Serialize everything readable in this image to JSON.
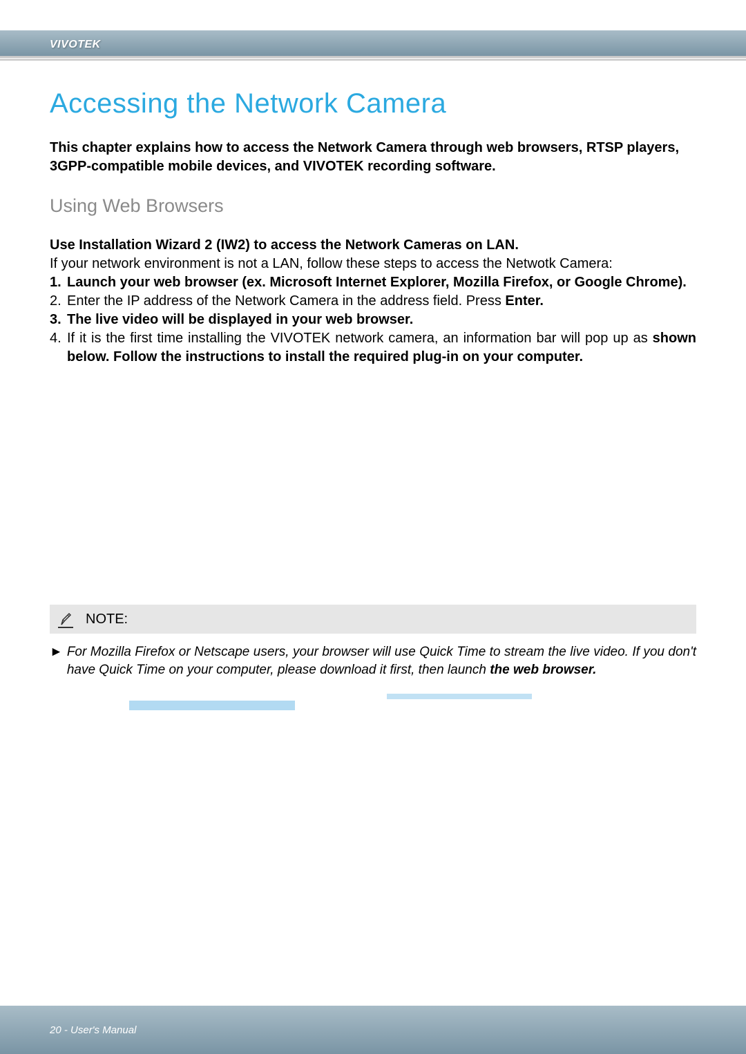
{
  "header": {
    "brand": "VIVOTEK"
  },
  "main_title": "Accessing the Network Camera",
  "intro": "This chapter explains how to access the Network Camera through web browsers, RTSP players, 3GPP-compatible mobile devices, and VIVOTEK recording software.",
  "section_title": "Using Web Browsers",
  "wizard_text": "Use Installation Wizard 2 (IW2) to access the Network Cameras on LAN.",
  "nonlan_text": "If your network environment is not a LAN, follow these steps to access the Netwotk Camera:",
  "steps": {
    "s1_num": "1.",
    "s1_text": "Launch your web browser (ex. Microsoft Internet Explorer, Mozilla Firefox, or Google Chrome).",
    "s2_num": "2.",
    "s2_text_a": "Enter the IP address of the Network Camera in the address field. Press ",
    "s2_text_b": "Enter",
    "s2_text_c": ".",
    "s3_num": "3.",
    "s3_text": "The live video will be displayed in your web browser.",
    "s4_num": "4.",
    "s4_text_a": "If it is the first time installing the VIVOTEK network camera, an information bar will pop up as",
    "s4_text_b": "shown below. Follow the instructions to install the required plug-in on your computer."
  },
  "note": {
    "label": "NOTE:",
    "arrow": "►",
    "body_a": "For Mozilla Firefox or Netscape users, your browser will use Quick Time to stream the live video. If you don't have Quick Time on your computer, please download it first, then launch ",
    "body_b": "the web browser."
  },
  "footer": {
    "text": "20 - User's Manual"
  }
}
